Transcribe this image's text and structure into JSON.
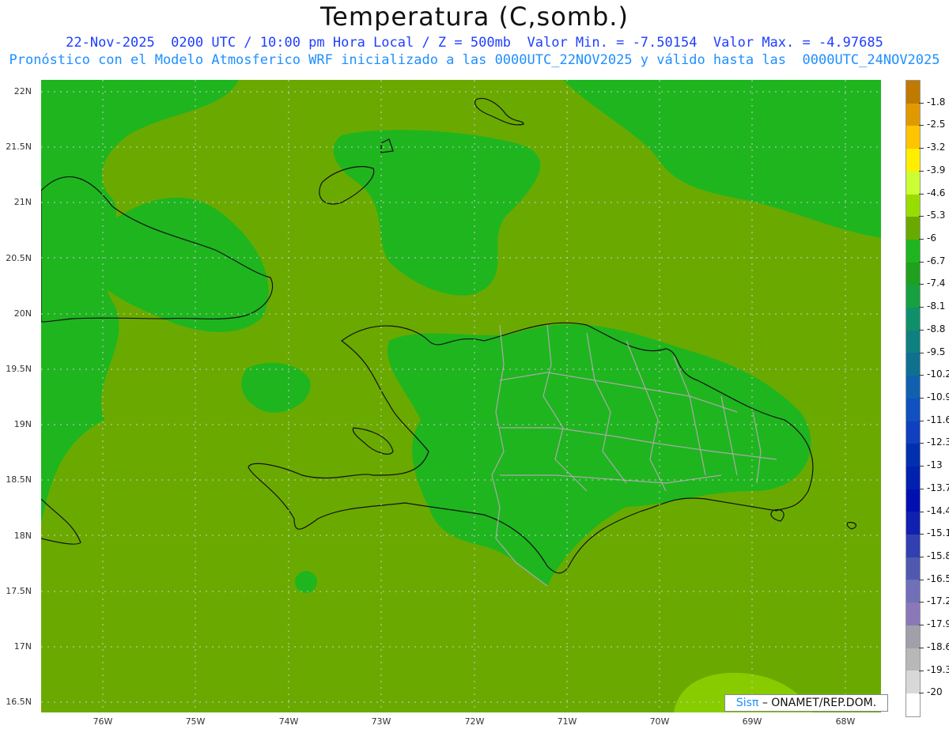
{
  "title": "Temperatura (C,somb.)",
  "subtitle1": "22-Nov-2025  0200 UTC / 10:00 pm Hora Local / Z = 500mb  Valor Min. = -7.50154  Valor Max. = -4.97685",
  "subtitle2": "Pronóstico con el Modelo Atmosferico WRF inicializado a las 0000UTC_22NOV2025 y válido hasta las  0000UTC_24NOV2025",
  "lat_labels": [
    "22N",
    "21.5N",
    "21N",
    "20.5N",
    "20N",
    "19.5N",
    "19N",
    "18.5N",
    "18N",
    "17.5N",
    "17N",
    "16.5N"
  ],
  "lon_labels": [
    "76W",
    "75W",
    "74W",
    "73W",
    "72W",
    "71W",
    "70W",
    "69W",
    "68W"
  ],
  "colorbar": {
    "labels": [
      "-1.8",
      "-2.5",
      "-3.2",
      "-3.9",
      "-4.6",
      "-5.3",
      "-6",
      "-6.7",
      "-7.4",
      "-8.1",
      "-8.8",
      "-9.5",
      "-10.2",
      "-10.9",
      "-11.6",
      "-12.3",
      "-13",
      "-13.7",
      "-14.4",
      "-15.1",
      "-15.8",
      "-16.5",
      "-17.2",
      "-17.9",
      "-18.6",
      "-19.3",
      "-20"
    ],
    "colors": [
      "#c07a00",
      "#e09a00",
      "#ffc400",
      "#ffee00",
      "#ccff33",
      "#99dd00",
      "#6aaa00",
      "#1fb51f",
      "#1fa01f",
      "#17a040",
      "#10906a",
      "#0f8080",
      "#0f7090",
      "#1060b0",
      "#1050c0",
      "#1040c0",
      "#0030b0",
      "#0020b0",
      "#0010b0",
      "#1020b0",
      "#3040b0",
      "#5058b0",
      "#7070b8",
      "#8a78b8",
      "#a0a0a8",
      "#b8b8b8",
      "#d8d8d8",
      "#ffffff"
    ]
  },
  "field_colors": {
    "background": "#6aaa00",
    "cold": "#1fb51f",
    "warm": "#88cc00"
  },
  "credit": {
    "sis": "Sisπ",
    "text": "– ONAMET/REP.DOM."
  }
}
